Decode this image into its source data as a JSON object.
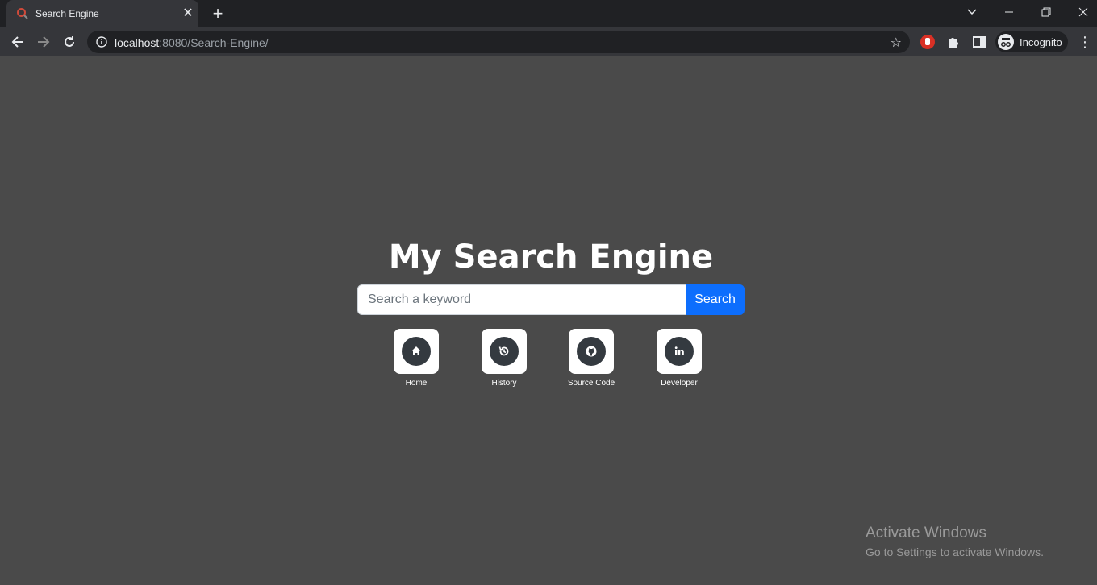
{
  "browser": {
    "tab_title": "Search Engine",
    "new_tab": "+",
    "url_host": "localhost",
    "url_rest": ":8080/Search-Engine/",
    "profile_label": "Incognito"
  },
  "main": {
    "title": "My Search Engine",
    "search_placeholder": "Search a keyword",
    "search_value": "",
    "search_button": "Search",
    "links": [
      {
        "label": "Home",
        "icon": "home-icon"
      },
      {
        "label": "History",
        "icon": "history-icon"
      },
      {
        "label": "Source Code",
        "icon": "github-icon"
      },
      {
        "label": "Developer",
        "icon": "linkedin-icon"
      }
    ]
  },
  "watermark": {
    "title": "Activate Windows",
    "subtitle": "Go to Settings to activate Windows."
  },
  "colors": {
    "page_background": "#4a4a4a",
    "search_button": "#0d6efd",
    "icon_circle": "#343a40"
  }
}
